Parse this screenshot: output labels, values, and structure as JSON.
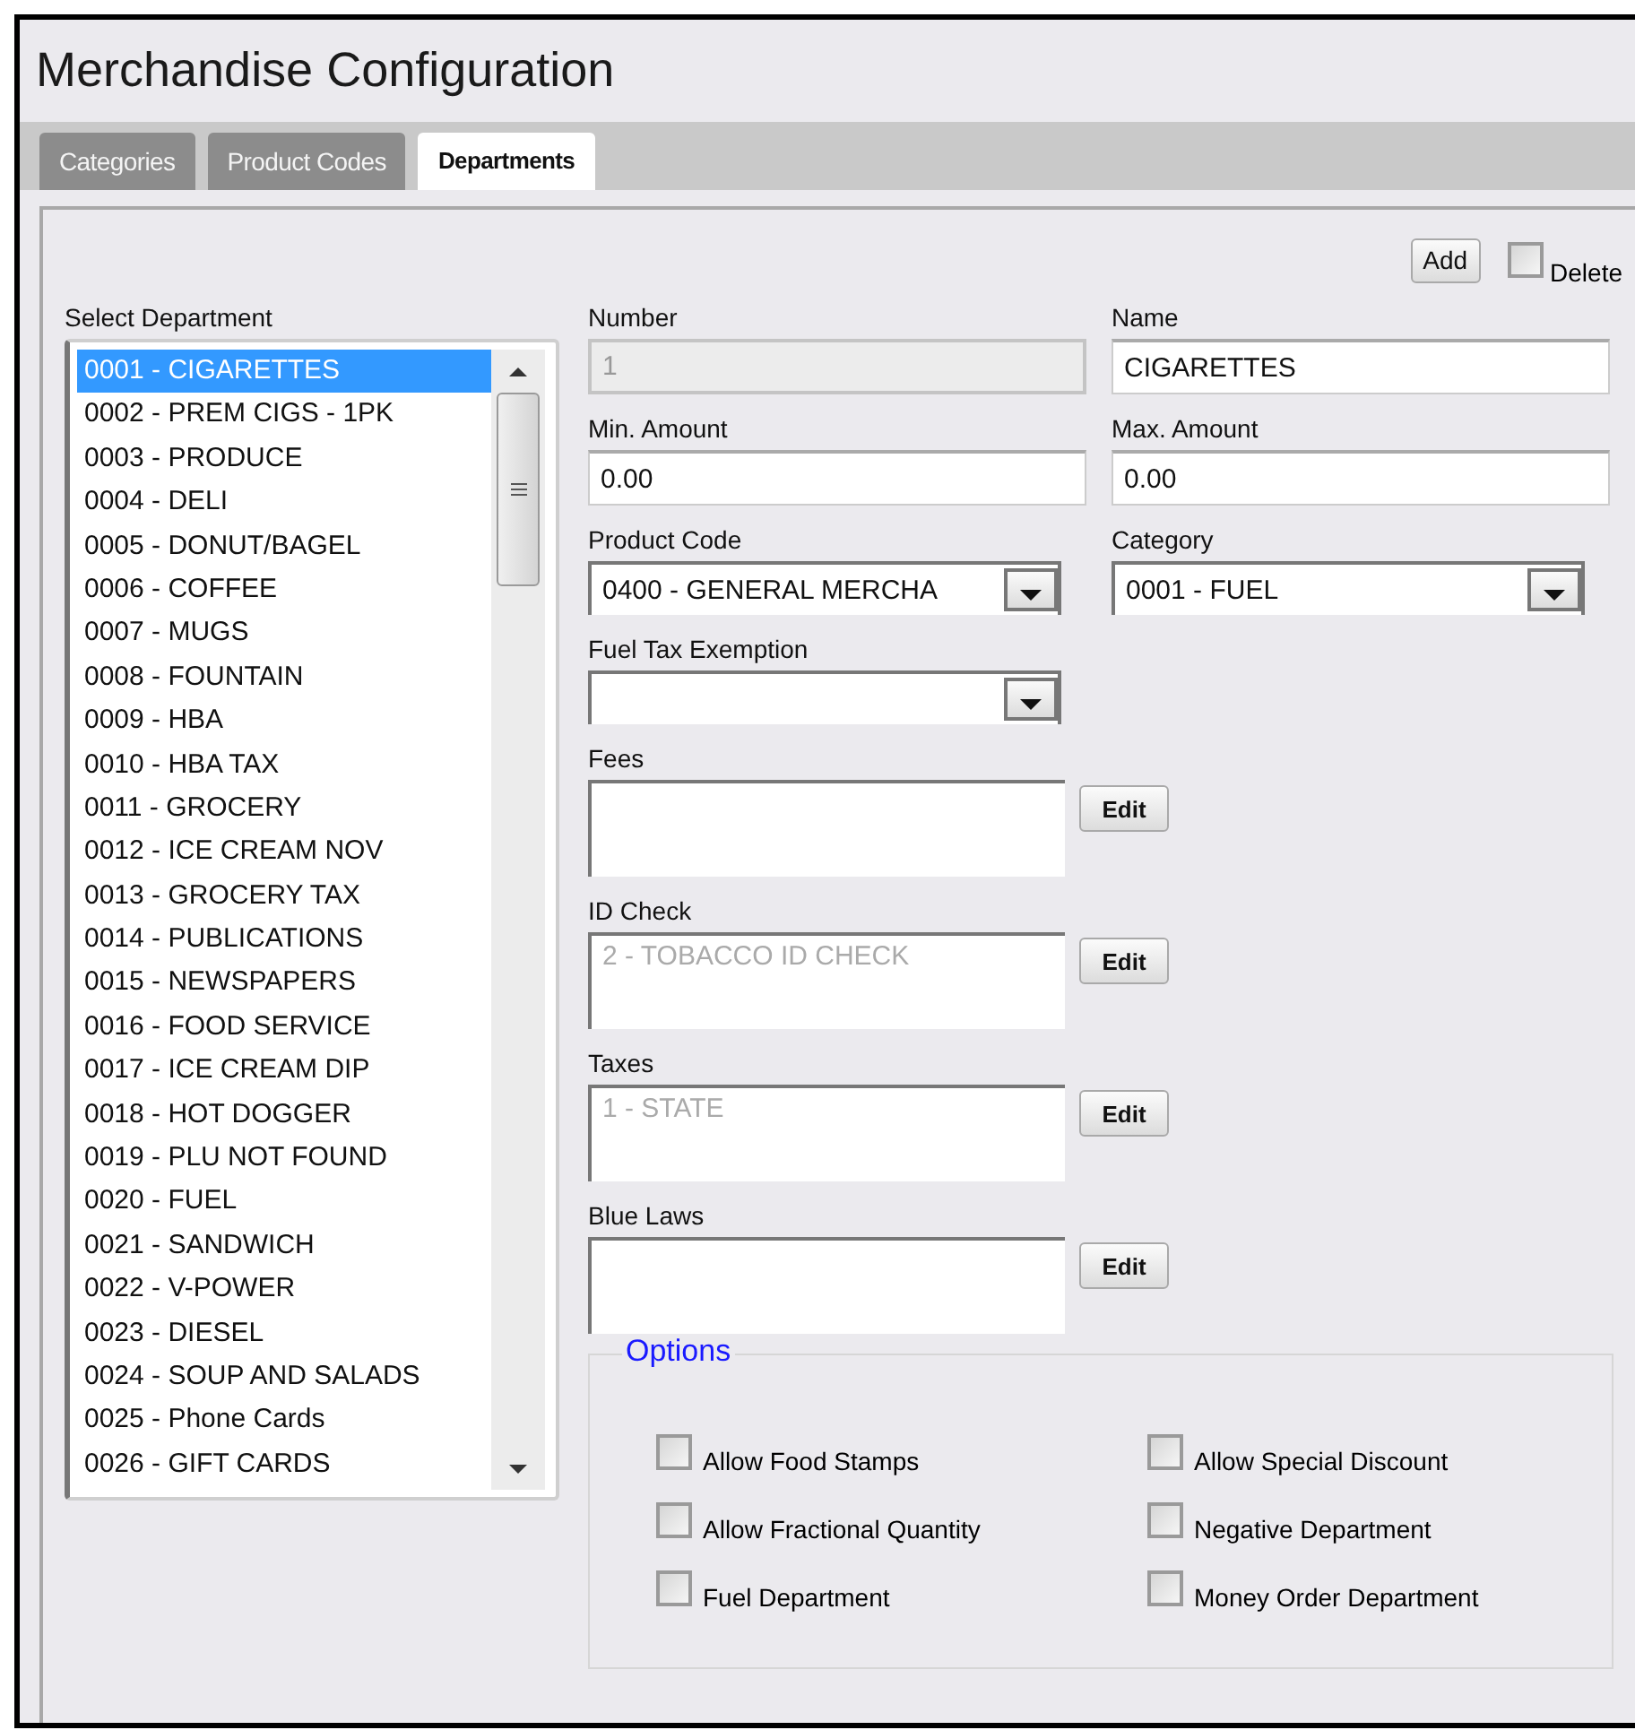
{
  "title": "Merchandise Configuration",
  "tabs": [
    {
      "label": "Categories",
      "selected": false
    },
    {
      "label": "Product Codes",
      "selected": false
    },
    {
      "label": "Departments",
      "selected": true
    }
  ],
  "toolbar": {
    "add_button": "Add",
    "delete": {
      "label": "Delete",
      "checked": false
    }
  },
  "department_list": {
    "label": "Select Department",
    "items": [
      {
        "label": "0001 - CIGARETTES",
        "selected": true
      },
      {
        "label": "0002 - PREM CIGS - 1PK",
        "selected": false
      },
      {
        "label": "0003 - PRODUCE",
        "selected": false
      },
      {
        "label": "0004 - DELI",
        "selected": false
      },
      {
        "label": "0005 - DONUT/BAGEL",
        "selected": false
      },
      {
        "label": "0006 - COFFEE",
        "selected": false
      },
      {
        "label": "0007 - MUGS",
        "selected": false
      },
      {
        "label": "0008 - FOUNTAIN",
        "selected": false
      },
      {
        "label": "0009 - HBA",
        "selected": false
      },
      {
        "label": "0010 - HBA TAX",
        "selected": false
      },
      {
        "label": "0011 - GROCERY",
        "selected": false
      },
      {
        "label": "0012 - ICE CREAM NOV",
        "selected": false
      },
      {
        "label": "0013 - GROCERY TAX",
        "selected": false
      },
      {
        "label": "0014 - PUBLICATIONS",
        "selected": false
      },
      {
        "label": "0015 - NEWSPAPERS",
        "selected": false
      },
      {
        "label": "0016 - FOOD SERVICE",
        "selected": false
      },
      {
        "label": "0017 - ICE CREAM DIP",
        "selected": false
      },
      {
        "label": "0018 - HOT DOGGER",
        "selected": false
      },
      {
        "label": "0019 - PLU NOT FOUND",
        "selected": false
      },
      {
        "label": "0020 - FUEL",
        "selected": false
      },
      {
        "label": "0021 - SANDWICH",
        "selected": false
      },
      {
        "label": "0022 - V-POWER",
        "selected": false
      },
      {
        "label": "0023 - DIESEL",
        "selected": false
      },
      {
        "label": "0024 - SOUP AND SALADS",
        "selected": false
      },
      {
        "label": "0025 - Phone Cards",
        "selected": false
      },
      {
        "label": "0026 - GIFT CARDS",
        "selected": false
      }
    ]
  },
  "fields": [
    {
      "kind": "input",
      "label": "Number",
      "value": "1",
      "readonly": true
    },
    {
      "kind": "input",
      "label": "Name",
      "value": "CIGARETTES",
      "readonly": false
    },
    {
      "kind": "input",
      "label": "Min. Amount",
      "value": "0.00",
      "readonly": false
    },
    {
      "kind": "input",
      "label": "Max. Amount",
      "value": "0.00",
      "readonly": false
    },
    {
      "kind": "select",
      "label": "Product Code",
      "value": "0400 - GENERAL MERCHA",
      "readonly": false
    },
    {
      "kind": "select",
      "label": "Category",
      "value": "0001 - FUEL",
      "readonly": false
    },
    {
      "kind": "select",
      "label": "Fuel Tax Exemption",
      "readonly": false
    }
  ],
  "lists": [
    {
      "label": "Fees",
      "edit_button": "Edit"
    },
    {
      "label": "ID Check",
      "value": "2 - TOBACCO ID CHECK",
      "edit_button": "Edit"
    },
    {
      "label": "Taxes",
      "value": "1 - STATE",
      "edit_button": "Edit"
    },
    {
      "label": "Blue Laws",
      "edit_button": "Edit"
    }
  ],
  "options": {
    "title": "Options",
    "items": [
      {
        "label": "Allow Food Stamps",
        "checked": false
      },
      {
        "label": "Allow Special Discount",
        "checked": false
      },
      {
        "label": "Allow Fractional Quantity",
        "checked": false
      },
      {
        "label": "Negative Department",
        "checked": false
      },
      {
        "label": "Fuel Department",
        "checked": false
      },
      {
        "label": "Money Order Department",
        "checked": false
      }
    ]
  }
}
